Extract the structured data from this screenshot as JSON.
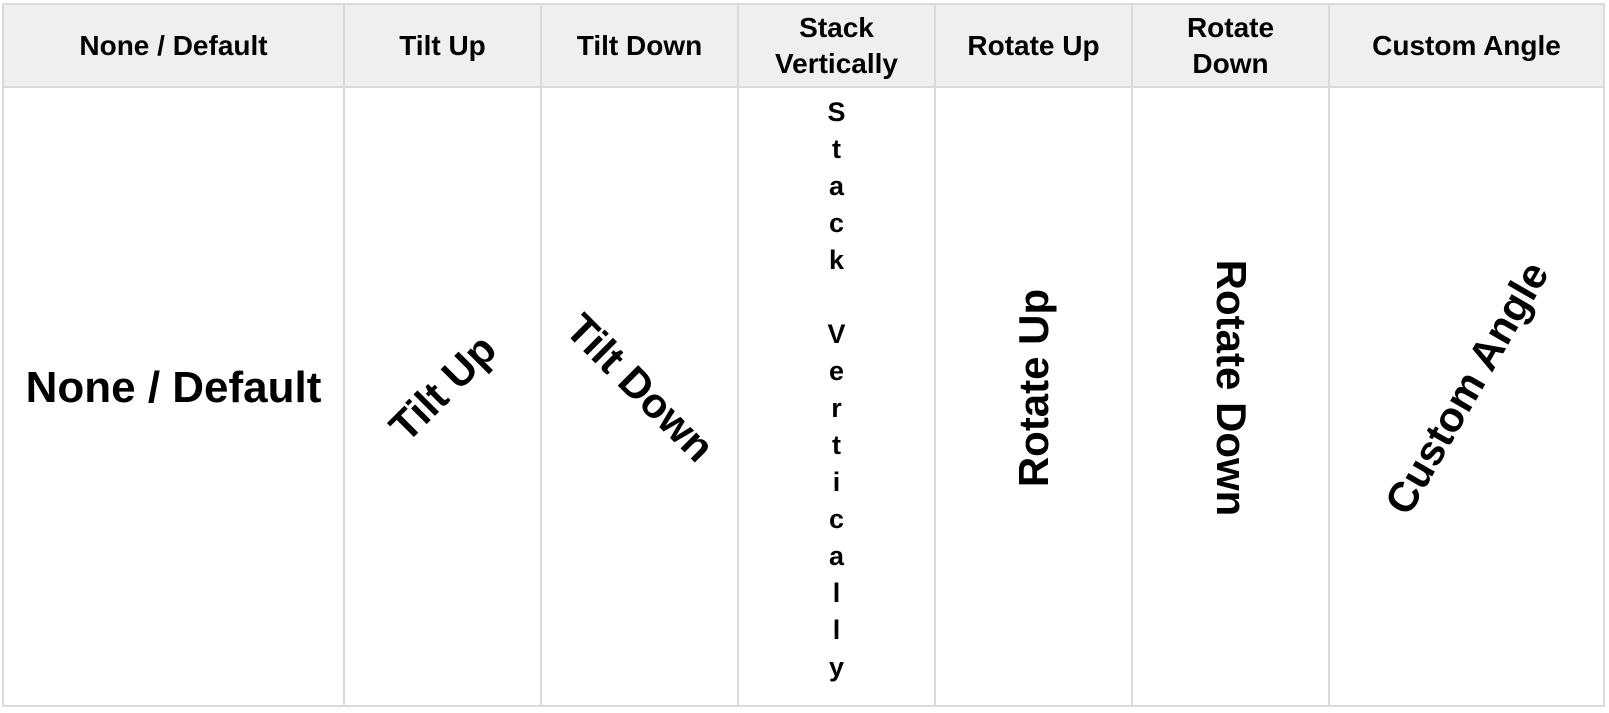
{
  "table": {
    "headers": [
      "None / Default",
      "Tilt Up",
      "Tilt Down",
      "Stack Vertically",
      "Rotate Up",
      "Rotate Down",
      "Custom Angle"
    ],
    "header_lines": {
      "stack_vertically": [
        "Stack",
        "Vertically"
      ],
      "rotate_down": [
        "Rotate",
        "Down"
      ]
    },
    "row": {
      "none_default": "None / Default",
      "tilt_up": "Tilt Up",
      "tilt_down": "Tilt Down",
      "stack_vertically_chars": [
        "S",
        "t",
        "a",
        "c",
        "k",
        " ",
        "V",
        "e",
        "r",
        "t",
        "i",
        "c",
        "a",
        "l",
        "l",
        "y"
      ],
      "rotate_up": "Rotate Up",
      "rotate_down": "Rotate Down",
      "custom_angle": "Custom Angle"
    },
    "colors": {
      "header_bg": "#efefef",
      "grid_line": "#dadada",
      "text": "#000000"
    }
  }
}
